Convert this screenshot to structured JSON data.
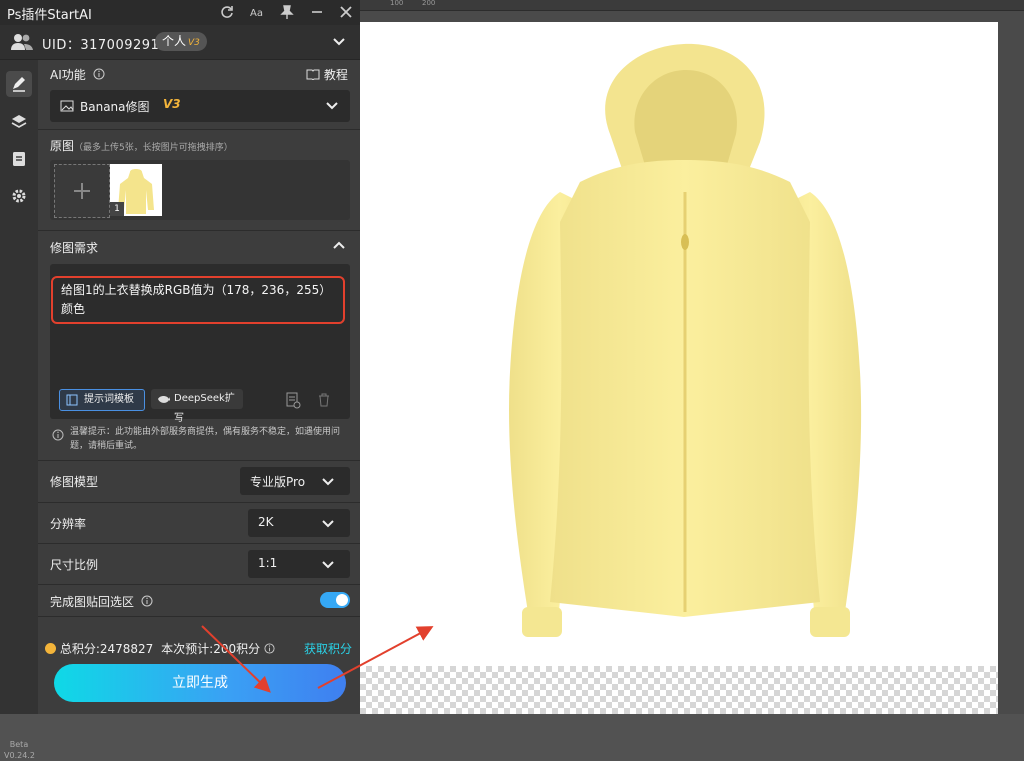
{
  "app": {
    "title": "Ps插件StartAI"
  },
  "user": {
    "uid_text": "UID：317009291",
    "tag_label": "个人",
    "tag_version": "V3"
  },
  "ai_function": {
    "label": "AI功能",
    "tutorial_label": "教程",
    "model_value": "Banana修图",
    "model_version": "V3"
  },
  "original_image": {
    "label": "原图",
    "hint": "（最多上传5张，长按图片可拖拽排序）",
    "thumb_index": "1"
  },
  "edit_requirement": {
    "label": "修图需求",
    "prompt_text": "给图1的上衣替换成RGB值为（178，236，255）颜色",
    "template_button": "提示词模板",
    "deepseek_button": "DeepSeek扩写"
  },
  "notice": {
    "text": "温馨提示：此功能由外部服务商提供，偶有服务不稳定，如遇使用问题，请稍后重试。"
  },
  "settings": {
    "model_label": "修图模型",
    "model_value": "专业版Pro",
    "resolution_label": "分辨率",
    "resolution_value": "2K",
    "ratio_label": "尺寸比例",
    "ratio_value": "1:1",
    "paste_label": "完成图贴回选区",
    "paste_enabled": true
  },
  "credits": {
    "total_text": "总积分:2478827",
    "estimate_text": "本次预计:200积分",
    "get_credits_label": "获取积分"
  },
  "generate_button": "立即生成",
  "beta": {
    "label": "Beta",
    "version": "V0.24.2"
  },
  "ruler": {
    "marks": [
      "100",
      "200"
    ]
  },
  "colors": {
    "accent": "#35a8f5",
    "highlight": "#e2402d",
    "version_gold": "#f3b43a",
    "jacket": "#fbef9c",
    "link": "#2ad1e6"
  }
}
